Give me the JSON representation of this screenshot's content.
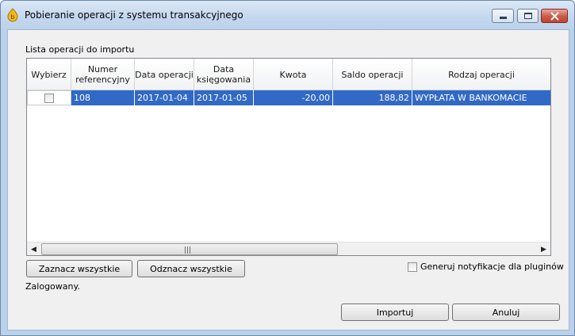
{
  "window": {
    "title": "Pobieranie operacji z systemu transakcyjnego"
  },
  "operations": {
    "section_label": "Lista operacji do importu",
    "columns": [
      "Wybierz",
      "Numer referencyjny",
      "Data operacji",
      "Data księgowania",
      "Kwota",
      "Saldo operacji",
      "Rodzaj operacji"
    ],
    "rows": [
      {
        "selected": false,
        "ref": "108",
        "op_date": "2017-01-04",
        "book_date": "2017-01-05",
        "amount": "-20,00",
        "balance": "188,82",
        "type": "WYPŁATA W BANKOMACIE"
      }
    ]
  },
  "actions": {
    "select_all": "Zaznacz wszystkie",
    "deselect_all": "Odznacz wszystkie",
    "notify_label": "Generuj notyfikacje dla pluginów",
    "notify_checked": false,
    "import": "Importuj",
    "cancel": "Anuluj"
  },
  "status": {
    "text": "Zalogowany."
  },
  "colors": {
    "selection": "#3169c6",
    "close_button": "#c7422c"
  }
}
